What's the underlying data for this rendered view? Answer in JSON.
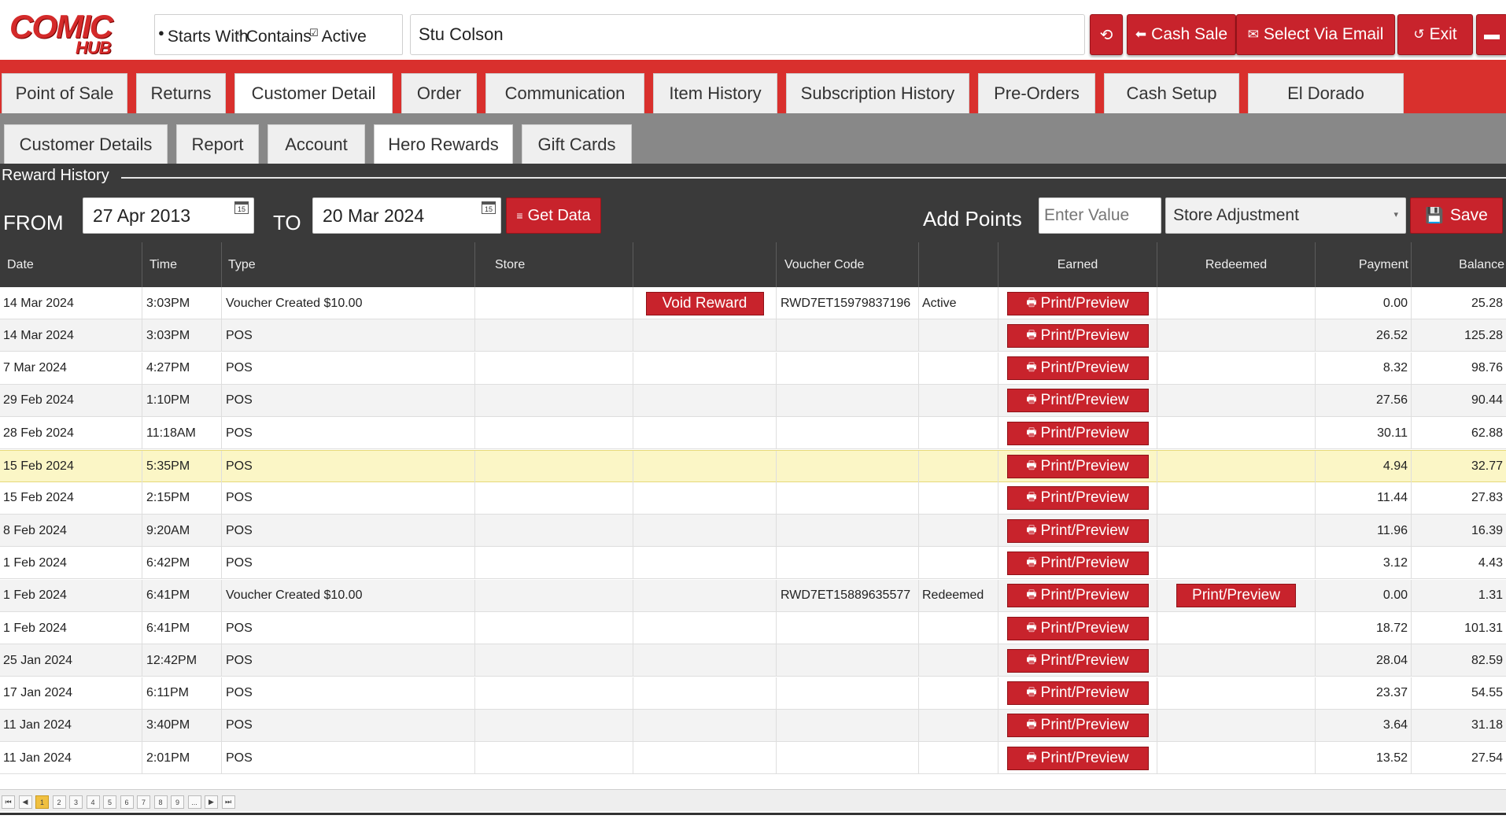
{
  "logo": {
    "line1": "COMIC",
    "line2": "HUB"
  },
  "search": {
    "starts_with": "Starts With",
    "contains": "Contains",
    "active": "Active",
    "name_value": "Stu Colson"
  },
  "top_buttons": {
    "cash_sale": "Cash Sale",
    "select_via_email": "Select Via Email",
    "exit": "Exit"
  },
  "main_tabs": [
    "Point of Sale",
    "Returns",
    "Customer Detail",
    "Order",
    "Communication",
    "Item History",
    "Subscription History",
    "Pre-Orders",
    "Cash Setup",
    "El Dorado"
  ],
  "sub_tabs": [
    "Customer Details",
    "Report",
    "Account",
    "Hero Rewards",
    "Gift Cards"
  ],
  "reward": {
    "legend": "Reward History",
    "from_label": "FROM",
    "from_date": "27 Apr 2013",
    "to_label": "TO",
    "to_date": "20 Mar 2024",
    "get_data": "Get Data",
    "add_points_label": "Add Points",
    "value_placeholder": "Enter Value",
    "adjust_type": "Store Adjustment",
    "save": "Save",
    "cal_day": "15"
  },
  "table": {
    "headers": [
      "Date",
      "Time",
      "Type",
      "Store",
      "",
      "Voucher Code",
      "",
      "Earned",
      "Redeemed",
      "Payment",
      "Balance"
    ],
    "print_label": "Print/Preview",
    "void_label": "Void Reward",
    "rows": [
      {
        "date": "14 Mar 2024",
        "time": "3:03PM",
        "type": "Voucher Created $10.00",
        "store": "",
        "void": true,
        "voucher": "RWD7ET15979837196",
        "status": "Active",
        "redeemed_btn": false,
        "payment": "0.00",
        "balance": "25.28"
      },
      {
        "date": "14 Mar 2024",
        "time": "3:03PM",
        "type": "POS",
        "store": "",
        "void": false,
        "voucher": "",
        "status": "",
        "redeemed_btn": false,
        "payment": "26.52",
        "balance": "125.28"
      },
      {
        "date": "7 Mar 2024",
        "time": "4:27PM",
        "type": "POS",
        "store": "",
        "void": false,
        "voucher": "",
        "status": "",
        "redeemed_btn": false,
        "payment": "8.32",
        "balance": "98.76"
      },
      {
        "date": "29 Feb 2024",
        "time": "1:10PM",
        "type": "POS",
        "store": "",
        "void": false,
        "voucher": "",
        "status": "",
        "redeemed_btn": false,
        "payment": "27.56",
        "balance": "90.44"
      },
      {
        "date": "28 Feb 2024",
        "time": "11:18AM",
        "type": "POS",
        "store": "",
        "void": false,
        "voucher": "",
        "status": "",
        "redeemed_btn": false,
        "payment": "30.11",
        "balance": "62.88"
      },
      {
        "date": "15 Feb 2024",
        "time": "5:35PM",
        "type": "POS",
        "store": "",
        "void": false,
        "voucher": "",
        "status": "",
        "redeemed_btn": false,
        "payment": "4.94",
        "balance": "32.77",
        "highlight": true
      },
      {
        "date": "15 Feb 2024",
        "time": "2:15PM",
        "type": "POS",
        "store": "",
        "void": false,
        "voucher": "",
        "status": "",
        "redeemed_btn": false,
        "payment": "11.44",
        "balance": "27.83"
      },
      {
        "date": "8 Feb 2024",
        "time": "9:20AM",
        "type": "POS",
        "store": "",
        "void": false,
        "voucher": "",
        "status": "",
        "redeemed_btn": false,
        "payment": "11.96",
        "balance": "16.39"
      },
      {
        "date": "1 Feb 2024",
        "time": "6:42PM",
        "type": "POS",
        "store": "",
        "void": false,
        "voucher": "",
        "status": "",
        "redeemed_btn": false,
        "payment": "3.12",
        "balance": "4.43"
      },
      {
        "date": "1 Feb 2024",
        "time": "6:41PM",
        "type": "Voucher Created $10.00",
        "store": "",
        "void": false,
        "voucher": "RWD7ET15889635577",
        "status": "Redeemed",
        "redeemed_btn": true,
        "payment": "0.00",
        "balance": "1.31"
      },
      {
        "date": "1 Feb 2024",
        "time": "6:41PM",
        "type": "POS",
        "store": "",
        "void": false,
        "voucher": "",
        "status": "",
        "redeemed_btn": false,
        "payment": "18.72",
        "balance": "101.31"
      },
      {
        "date": "25 Jan 2024",
        "time": "12:42PM",
        "type": "POS",
        "store": "",
        "void": false,
        "voucher": "",
        "status": "",
        "redeemed_btn": false,
        "payment": "28.04",
        "balance": "82.59"
      },
      {
        "date": "17 Jan 2024",
        "time": "6:11PM",
        "type": "POS",
        "store": "",
        "void": false,
        "voucher": "",
        "status": "",
        "redeemed_btn": false,
        "payment": "23.37",
        "balance": "54.55"
      },
      {
        "date": "11 Jan 2024",
        "time": "3:40PM",
        "type": "POS",
        "store": "",
        "void": false,
        "voucher": "",
        "status": "",
        "redeemed_btn": false,
        "payment": "3.64",
        "balance": "31.18"
      },
      {
        "date": "11 Jan 2024",
        "time": "2:01PM",
        "type": "POS",
        "store": "",
        "void": false,
        "voucher": "",
        "status": "",
        "redeemed_btn": false,
        "payment": "13.52",
        "balance": "27.54"
      }
    ]
  },
  "pager": {
    "first": "⏮",
    "prev": "◀",
    "pages": [
      "1",
      "2",
      "3",
      "4",
      "5",
      "6",
      "7",
      "8",
      "9",
      "..."
    ],
    "next": "▶",
    "last": "⏭",
    "current": "1"
  },
  "colors": {
    "accent_red": "#c8232c",
    "tab_bar_red": "#d9302d",
    "dark": "#3a3a3a",
    "highlight": "#fbf6c6"
  }
}
